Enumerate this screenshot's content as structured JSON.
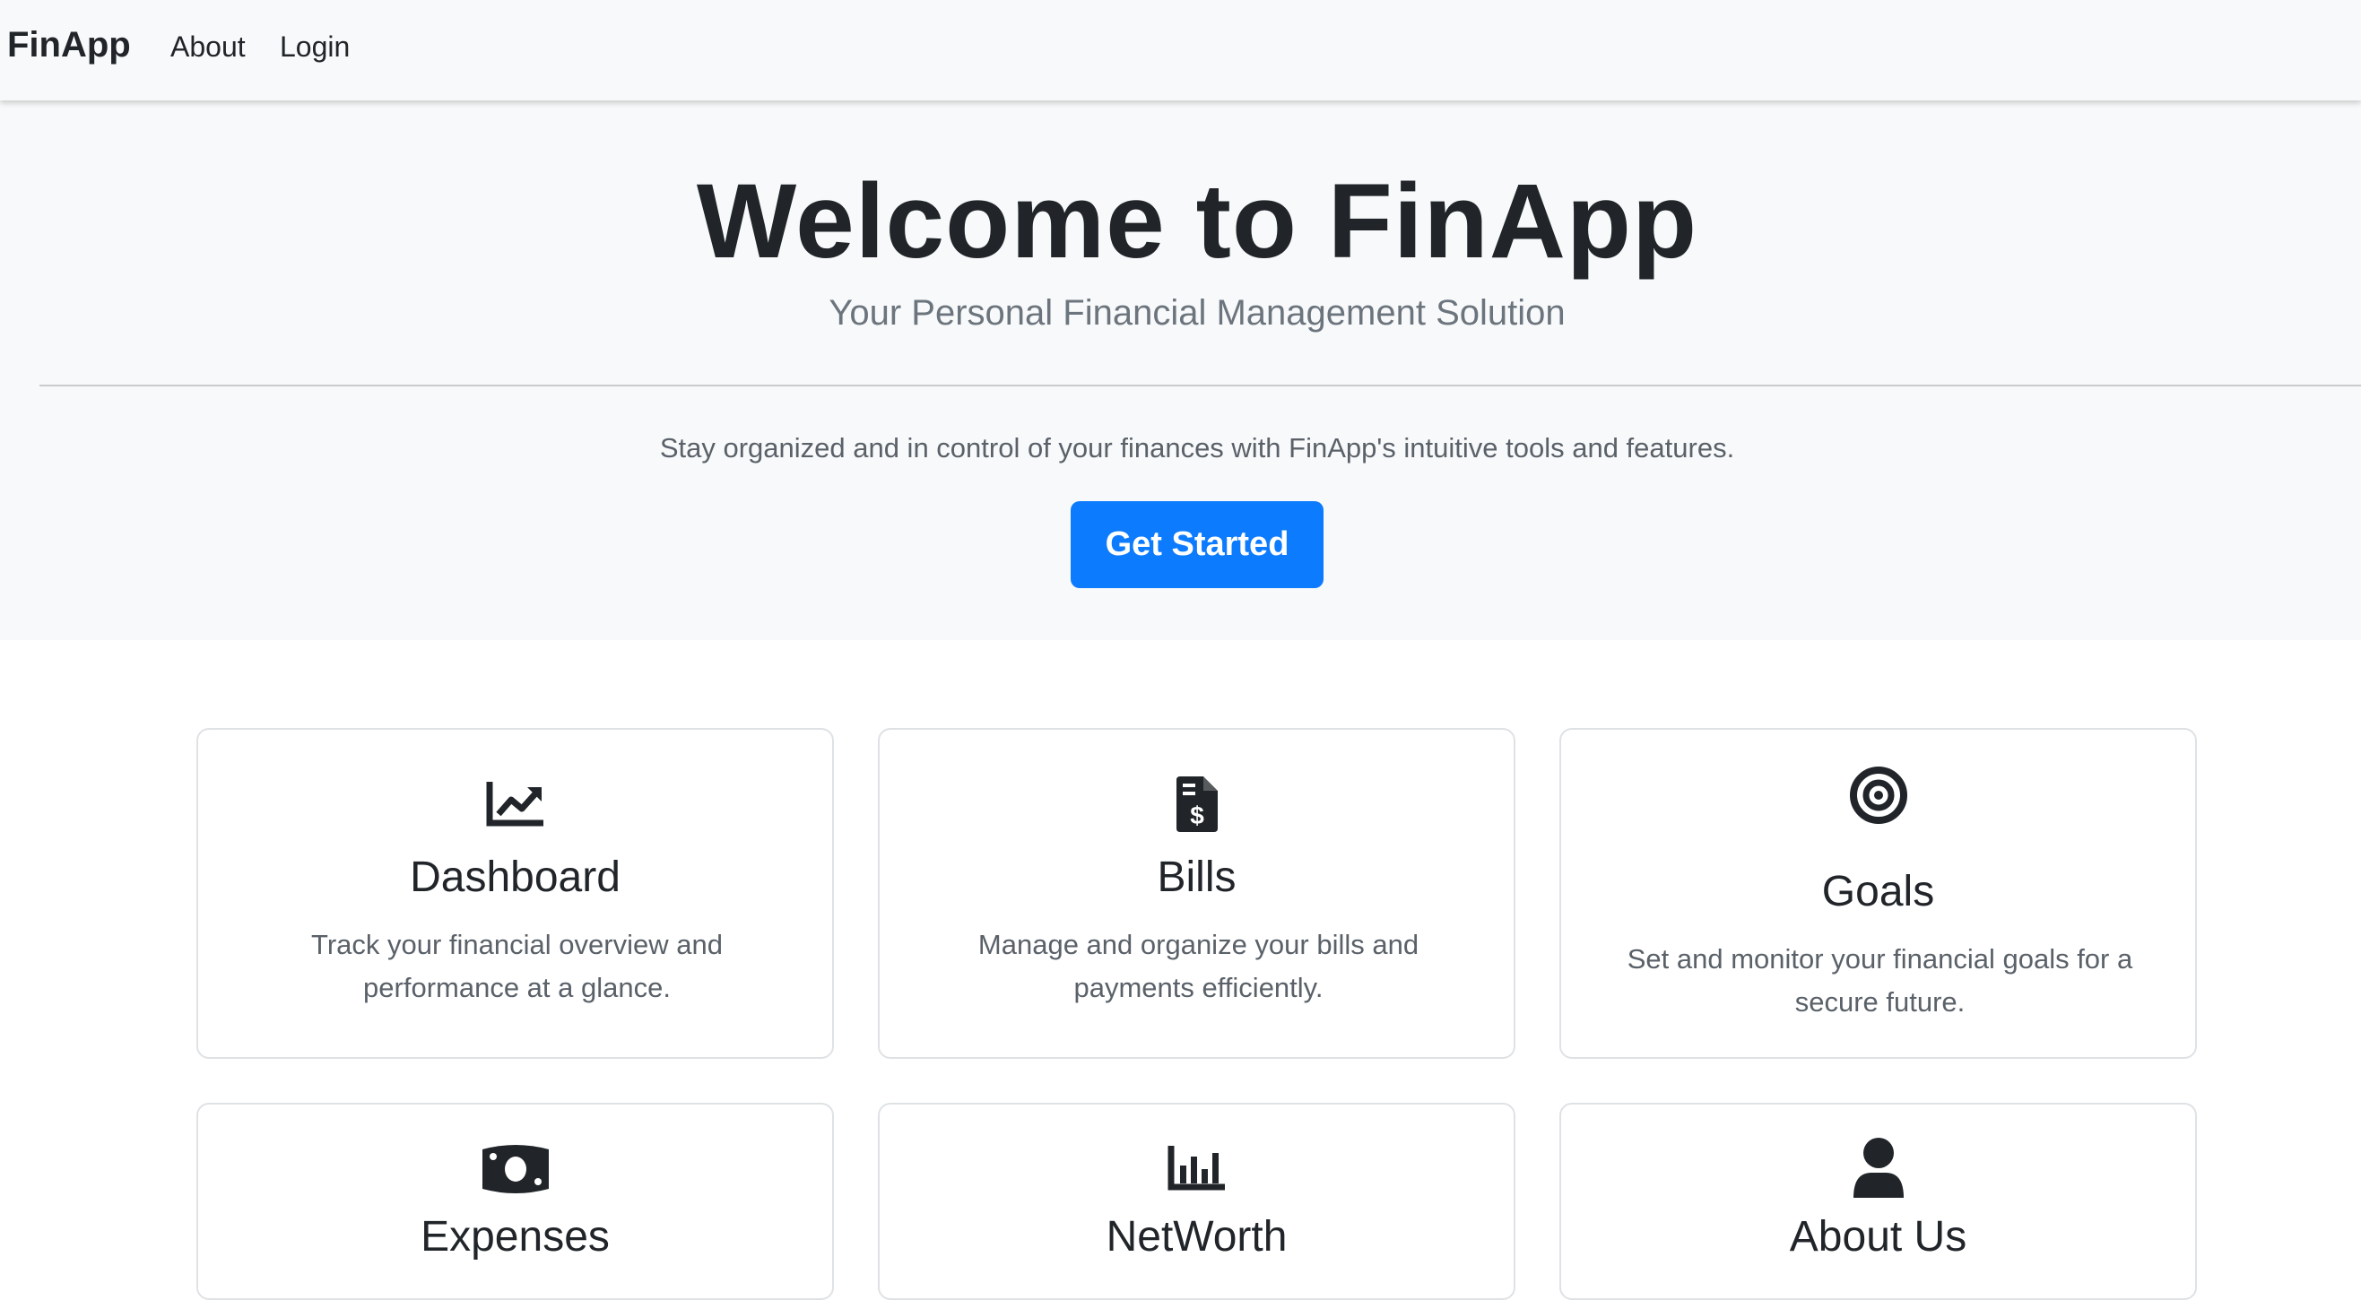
{
  "navbar": {
    "brand": "FinApp",
    "links": [
      {
        "label": "About"
      },
      {
        "label": "Login"
      }
    ]
  },
  "hero": {
    "title": "Welcome to FinApp",
    "subtitle": "Your Personal Financial Management Solution",
    "text": "Stay organized and in control of your finances with FinApp's intuitive tools and features.",
    "cta_label": "Get Started",
    "cta_color": "#0d7bfd"
  },
  "features": [
    {
      "icon": "chart-line-icon",
      "title": "Dashboard",
      "text": "Track your financial overview and performance at a glance."
    },
    {
      "icon": "file-invoice-dollar-icon",
      "title": "Bills",
      "text": "Manage and organize your bills and payments efficiently."
    },
    {
      "icon": "bullseye-icon",
      "title": "Goals",
      "text": "Set and monitor your financial goals for a secure future."
    },
    {
      "icon": "money-bill-icon",
      "title": "Expenses",
      "text": ""
    },
    {
      "icon": "bar-chart-icon",
      "title": "NetWorth",
      "text": ""
    },
    {
      "icon": "user-icon",
      "title": "About Us",
      "text": ""
    }
  ]
}
